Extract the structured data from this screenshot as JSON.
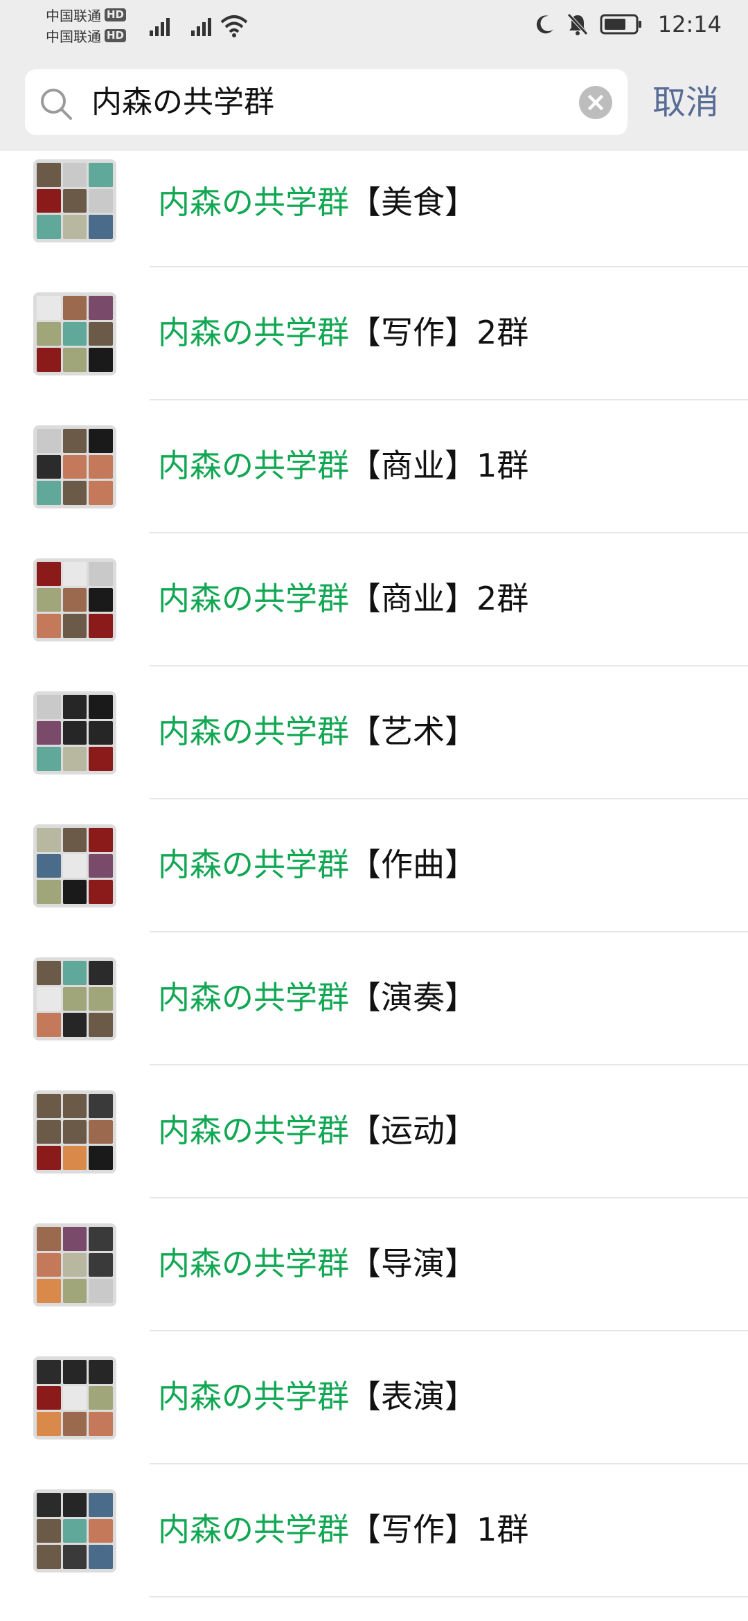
{
  "status_bar": {
    "carrier_1": "中国联通",
    "carrier_2": "中国联通",
    "hd_badge": "HD",
    "time": "12:14",
    "icons": [
      "signal-icon",
      "signal-icon",
      "wifi-icon",
      "moon-icon",
      "mute-bell-icon",
      "battery-icon"
    ]
  },
  "search": {
    "query": "内森の共学群",
    "cancel_label": "取消"
  },
  "results": [
    {
      "highlight": "内森の共学群",
      "rest": "【美食】"
    },
    {
      "highlight": "内森の共学群",
      "rest": "【写作】2群"
    },
    {
      "highlight": "内森の共学群",
      "rest": "【商业】1群"
    },
    {
      "highlight": "内森の共学群",
      "rest": "【商业】2群"
    },
    {
      "highlight": "内森の共学群",
      "rest": "【艺术】"
    },
    {
      "highlight": "内森の共学群",
      "rest": "【作曲】"
    },
    {
      "highlight": "内森の共学群",
      "rest": "【演奏】"
    },
    {
      "highlight": "内森の共学群",
      "rest": "【运动】"
    },
    {
      "highlight": "内森の共学群",
      "rest": "【导演】"
    },
    {
      "highlight": "内森の共学群",
      "rest": "【表演】"
    },
    {
      "highlight": "内森の共学群",
      "rest": "【写作】1群"
    }
  ],
  "colors": {
    "highlight": "#12a853",
    "link": "#576b95",
    "header_bg": "#ededed"
  }
}
